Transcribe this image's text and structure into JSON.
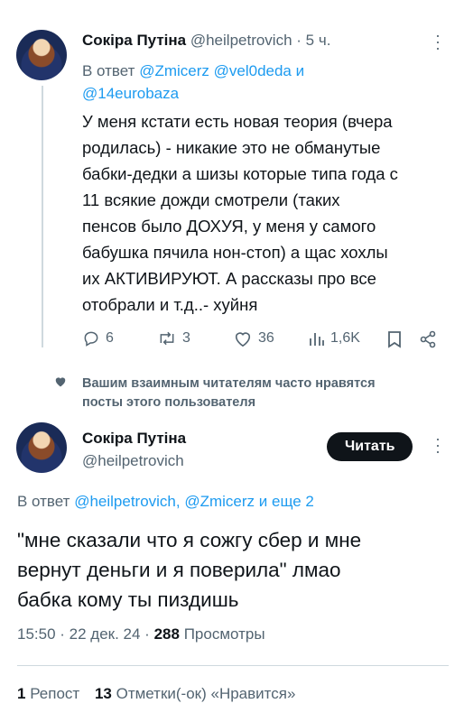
{
  "tweet1": {
    "name": "Сокіра Путіна",
    "handle": "@heilpetrovich",
    "time": "· 5 ч.",
    "reply_prefix": "В ответ",
    "reply_users": [
      "@Zmicerz",
      "@vel0deda",
      "и",
      "@14eurobaza"
    ],
    "text_lines": [
      "У меня кстати есть новая теория (вчера",
      "родилась) - никакие это не обманутые",
      "бабки-дедки а шизы которые типа года с",
      "11 всякие дожди смотрели (таких",
      "пенсов было ДОХУЯ, у меня у самого",
      "бабушка пячила нон-стоп) а щас хохлы",
      "их АКТИВИРУЮТ. А рассказы про все",
      "отобрали и т.д..- хуйня"
    ],
    "replies": "6",
    "reposts": "3",
    "likes": "36",
    "views": "1,6K"
  },
  "suggestion": {
    "text_line1": "Вашим взаимным читателям часто нравятся",
    "text_line2": "посты этого пользователя"
  },
  "tweet2": {
    "name": "Сокіра Путіна",
    "handle": "@heilpetrovich",
    "follow_label": "Читать",
    "reply_prefix": "В ответ",
    "reply_users": "@heilpetrovich, @Zmicerz",
    "reply_suffix": "и еще 2",
    "text_lines": [
      "\"мне сказали что я сожгу сбер и мне",
      "вернут деньги и я поверила\" лмао",
      "бабка кому ты пиздишь"
    ],
    "timestamp": "15:50 · 22 дек. 24 ·",
    "views_count": "288",
    "views_label": "Просмотры",
    "reposts_count": "1",
    "reposts_label": "Репост",
    "likes_count": "13",
    "likes_label": "Отметки(-ок) «Нравится»"
  }
}
